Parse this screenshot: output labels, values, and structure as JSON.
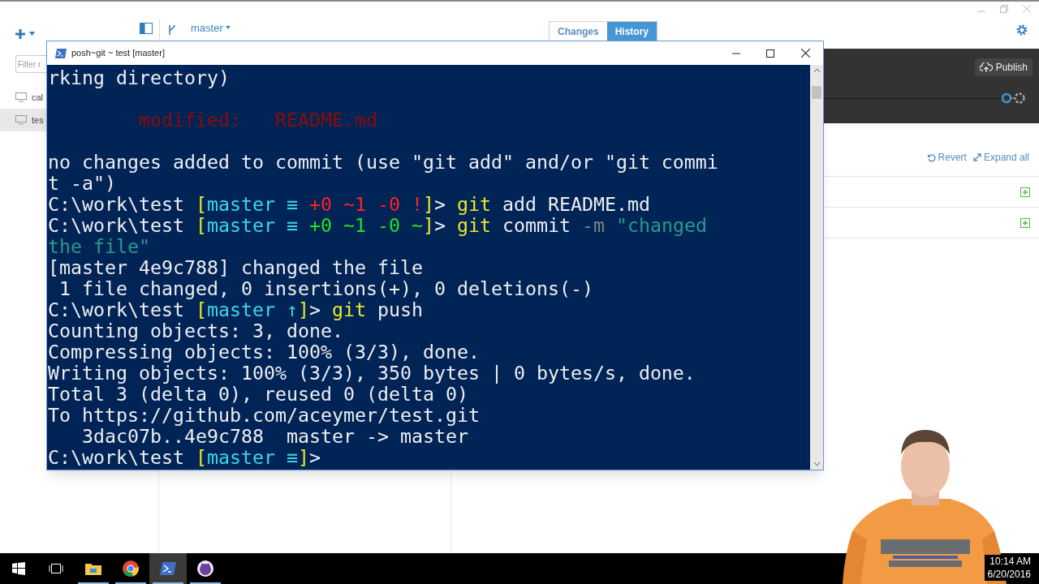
{
  "app": {
    "branch": "master",
    "tabs": [
      {
        "label": "Changes",
        "selected": false
      },
      {
        "label": "History",
        "selected": true
      }
    ],
    "filter": {
      "placeholder": "Filter r"
    },
    "repositories": [
      {
        "name": "cal",
        "selected": false
      },
      {
        "name": "tes",
        "selected": true
      }
    ],
    "publish": "Publish",
    "revert": "Revert",
    "expand_all": "Expand all",
    "file_rows": [
      {
        "kind": "added"
      },
      {
        "kind": "added"
      }
    ]
  },
  "terminal": {
    "title": "posh~git ~ test [master]",
    "lines": [
      {
        "kind": "text",
        "segments": [
          {
            "text": "rking directory)",
            "color": "#eeedf0"
          }
        ]
      },
      {
        "kind": "blank"
      },
      {
        "kind": "text",
        "segments": [
          {
            "text": "        modified:   README.md",
            "color": "#8b0a0a"
          }
        ]
      },
      {
        "kind": "blank"
      },
      {
        "kind": "text",
        "segments": [
          {
            "text": "no changes added to commit (use \"git add\" and/or \"git commi",
            "color": "#eeedf0"
          }
        ]
      },
      {
        "kind": "text",
        "segments": [
          {
            "text": "t -a\")",
            "color": "#eeedf0"
          }
        ]
      },
      {
        "kind": "text",
        "segments": [
          {
            "text": "C:\\work\\test ",
            "color": "#eeedf0"
          },
          {
            "text": "[",
            "color": "#e8e82a"
          },
          {
            "text": "master ≡ ",
            "color": "#3ad6e6"
          },
          {
            "text": "+0 ~1 -0 !",
            "color": "#ff2020"
          },
          {
            "text": "]",
            "color": "#e8e82a"
          },
          {
            "text": "> ",
            "color": "#eeedf0"
          },
          {
            "text": "git",
            "color": "#e8e82a"
          },
          {
            "text": " add README.md",
            "color": "#eeedf0"
          }
        ]
      },
      {
        "kind": "text",
        "segments": [
          {
            "text": "C:\\work\\test ",
            "color": "#eeedf0"
          },
          {
            "text": "[",
            "color": "#e8e82a"
          },
          {
            "text": "master ≡ ",
            "color": "#3ad6e6"
          },
          {
            "text": "+0 ~1 -0 ~",
            "color": "#22e022"
          },
          {
            "text": "]",
            "color": "#e8e82a"
          },
          {
            "text": "> ",
            "color": "#eeedf0"
          },
          {
            "text": "git",
            "color": "#e8e82a"
          },
          {
            "text": " commit ",
            "color": "#eeedf0"
          },
          {
            "text": "-m",
            "color": "#808080"
          },
          {
            "text": " \"changed",
            "color": "#2a9a8c"
          }
        ]
      },
      {
        "kind": "text",
        "segments": [
          {
            "text": "the file\"",
            "color": "#2a9a8c"
          }
        ]
      },
      {
        "kind": "text",
        "segments": [
          {
            "text": "[master 4e9c788] changed the file",
            "color": "#eeedf0"
          }
        ]
      },
      {
        "kind": "text",
        "segments": [
          {
            "text": " 1 file changed, 0 insertions(+), 0 deletions(-)",
            "color": "#eeedf0"
          }
        ]
      },
      {
        "kind": "text",
        "segments": [
          {
            "text": "C:\\work\\test ",
            "color": "#eeedf0"
          },
          {
            "text": "[",
            "color": "#e8e82a"
          },
          {
            "text": "master ↑",
            "color": "#3ad6e6"
          },
          {
            "text": "]",
            "color": "#e8e82a"
          },
          {
            "text": "> ",
            "color": "#eeedf0"
          },
          {
            "text": "git",
            "color": "#e8e82a"
          },
          {
            "text": " push",
            "color": "#eeedf0"
          }
        ]
      },
      {
        "kind": "text",
        "segments": [
          {
            "text": "Counting objects: 3, done.",
            "color": "#eeedf0"
          }
        ]
      },
      {
        "kind": "text",
        "segments": [
          {
            "text": "Compressing objects: 100% (3/3), done.",
            "color": "#eeedf0"
          }
        ]
      },
      {
        "kind": "text",
        "segments": [
          {
            "text": "Writing objects: 100% (3/3), 350 bytes | 0 bytes/s, done.",
            "color": "#eeedf0"
          }
        ]
      },
      {
        "kind": "text",
        "segments": [
          {
            "text": "Total 3 (delta 0), reused 0 (delta 0)",
            "color": "#eeedf0"
          }
        ]
      },
      {
        "kind": "text",
        "segments": [
          {
            "text": "To https://github.com/aceymer/test.git",
            "color": "#eeedf0"
          }
        ]
      },
      {
        "kind": "text",
        "segments": [
          {
            "text": "   3dac07b..4e9c788  master -> master",
            "color": "#eeedf0"
          }
        ]
      },
      {
        "kind": "text",
        "segments": [
          {
            "text": "C:\\work\\test ",
            "color": "#eeedf0"
          },
          {
            "text": "[",
            "color": "#e8e82a"
          },
          {
            "text": "master ≡",
            "color": "#3ad6e6"
          },
          {
            "text": "]",
            "color": "#e8e82a"
          },
          {
            "text": "> ",
            "color": "#eeedf0"
          }
        ]
      }
    ]
  },
  "taskbar": {
    "apps": [
      {
        "kind": "start",
        "active": false,
        "running": false
      },
      {
        "kind": "taskview",
        "active": false,
        "running": false
      },
      {
        "kind": "folder",
        "active": false,
        "running": true
      },
      {
        "kind": "browser",
        "active": false,
        "running": true
      },
      {
        "kind": "shell",
        "active": true,
        "running": true
      },
      {
        "kind": "cat",
        "active": false,
        "running": true
      }
    ],
    "time": "10:14 AM",
    "date": "6/20/2016"
  }
}
